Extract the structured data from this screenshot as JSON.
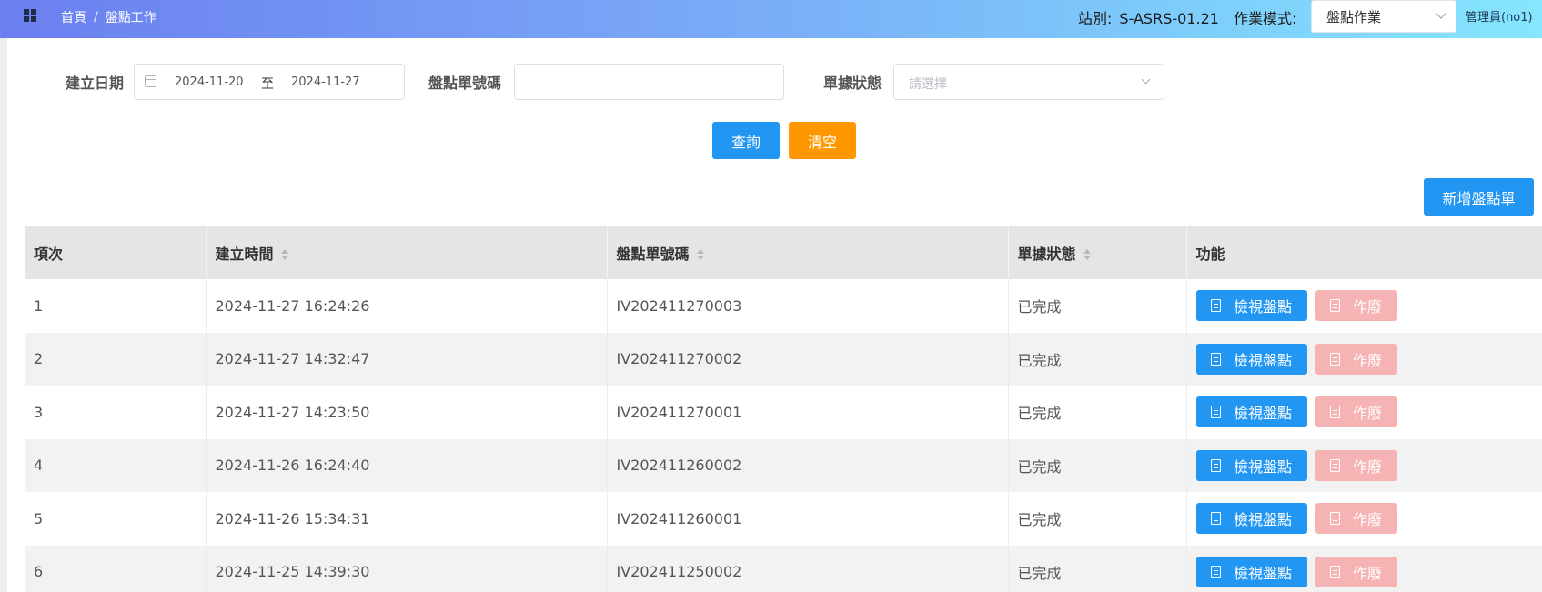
{
  "header": {
    "breadcrumb": [
      "首頁",
      "盤點工作"
    ],
    "breadcrumb_sep": "/",
    "station_label": "站別:",
    "station_value": "S-ASRS-01.21",
    "mode_label": "作業模式:",
    "mode_value": "盤點作業",
    "user": "管理員(no1)"
  },
  "filters": {
    "date_label": "建立日期",
    "date_from": "2024-11-20",
    "date_to_word": "至",
    "date_to": "2024-11-27",
    "order_no_label": "盤點單號碼",
    "order_no_value": "",
    "status_label": "單據狀態",
    "status_placeholder": "請選擇"
  },
  "buttons": {
    "query": "查詢",
    "clear": "清空",
    "new_order": "新增盤點單"
  },
  "table": {
    "columns": [
      "項次",
      "建立時間",
      "盤點單號碼",
      "單據狀態",
      "功能"
    ],
    "view_label": "檢視盤點",
    "void_label": "作廢",
    "rows": [
      {
        "no": "1",
        "time": "2024-11-27 16:24:26",
        "order": "IV202411270003",
        "status": "已完成"
      },
      {
        "no": "2",
        "time": "2024-11-27 14:32:47",
        "order": "IV202411270002",
        "status": "已完成"
      },
      {
        "no": "3",
        "time": "2024-11-27 14:23:50",
        "order": "IV202411270001",
        "status": "已完成"
      },
      {
        "no": "4",
        "time": "2024-11-26 16:24:40",
        "order": "IV202411260002",
        "status": "已完成"
      },
      {
        "no": "5",
        "time": "2024-11-26 15:34:31",
        "order": "IV202411260001",
        "status": "已完成"
      },
      {
        "no": "6",
        "time": "2024-11-25 14:39:30",
        "order": "IV202411250002",
        "status": "已完成"
      }
    ]
  }
}
